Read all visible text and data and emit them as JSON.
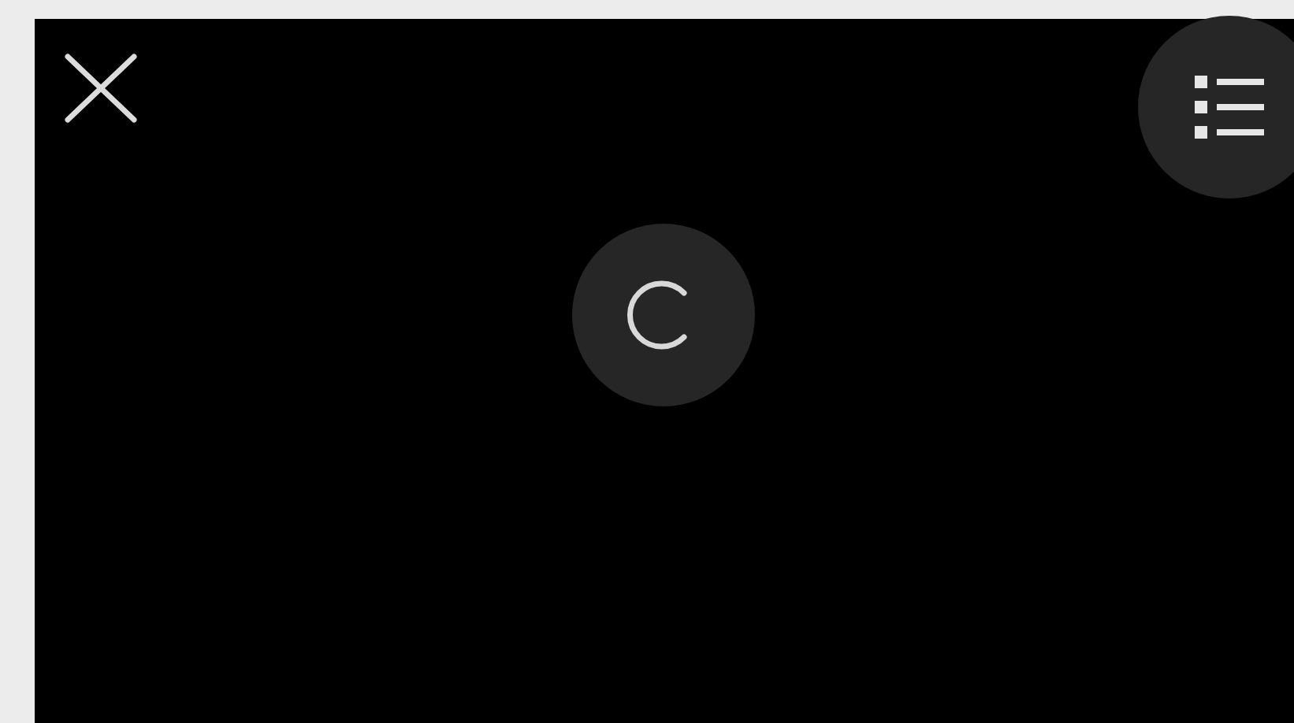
{
  "viewer": {
    "loading": true
  }
}
